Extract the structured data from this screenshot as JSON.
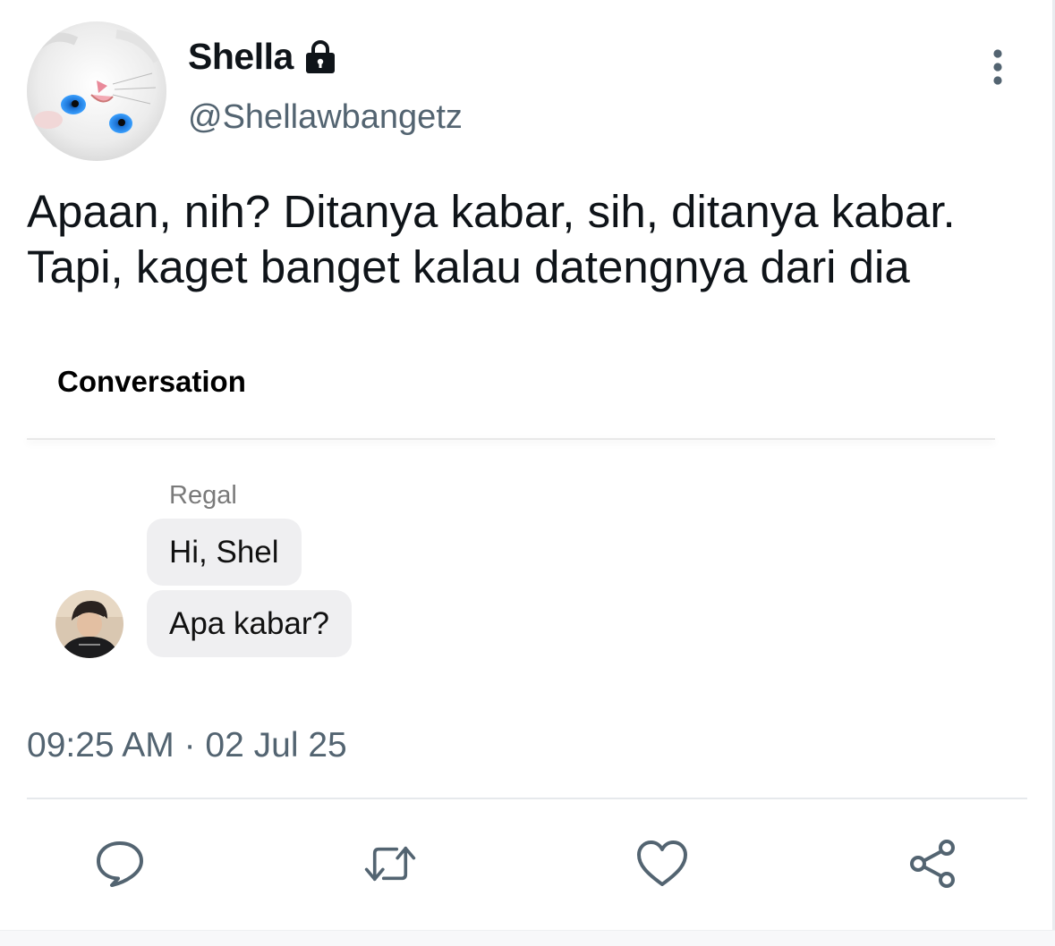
{
  "tweet": {
    "author": {
      "display_name": "Shella",
      "handle": "@Shellawbangetz",
      "avatar_icon": "white-cat-avatar",
      "protected_icon": "lock-icon"
    },
    "text_lines": [
      "Apaan, nih? Ditanya kabar, sih, ditanya kabar.",
      "Tapi, kaget banget kalau datengnya dari dia"
    ],
    "more_icon": "more-vertical-icon",
    "timestamp": "09:25 AM · 02 Jul 25"
  },
  "conversation": {
    "title": "Conversation",
    "sender": "Regal",
    "sender_avatar_icon": "person-photo-avatar",
    "messages": [
      "Hi, Shel",
      "Apa kabar?"
    ]
  },
  "actions": {
    "reply_icon": "reply-icon",
    "retweet_icon": "retweet-icon",
    "like_icon": "heart-icon",
    "share_icon": "share-icon"
  },
  "colors": {
    "text_primary": "#0f1419",
    "text_secondary": "#536471",
    "bubble_bg": "#efeff1",
    "icon_gray": "#536471"
  }
}
